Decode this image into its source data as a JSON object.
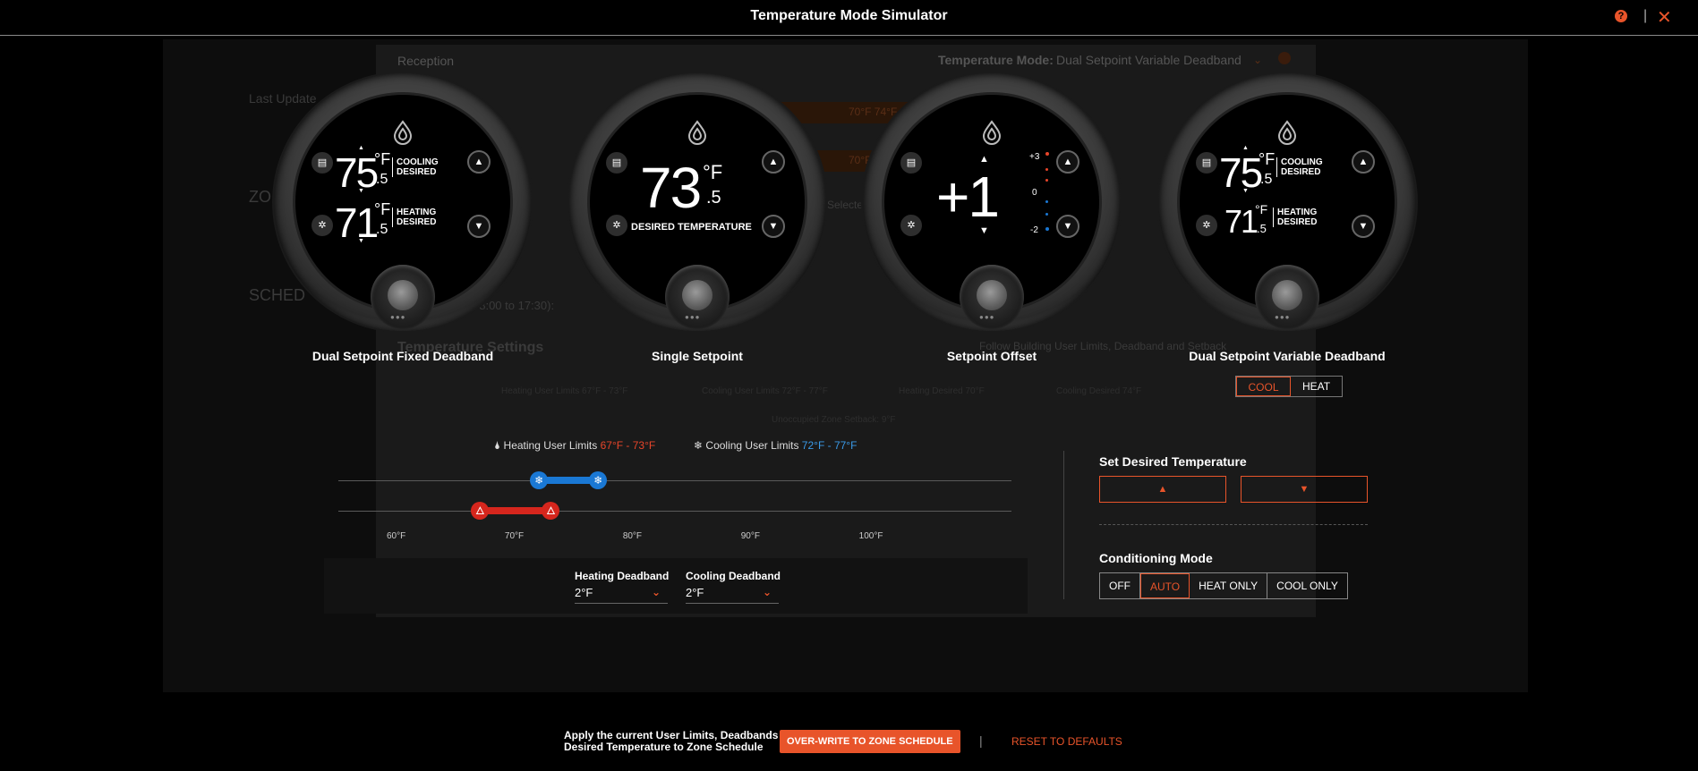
{
  "window": {
    "title": "Temperature Mode Simulator",
    "help_icon": "?",
    "separator": "|",
    "close_icon": "✕"
  },
  "background": {
    "zone": "Reception",
    "temperature_mode_label": "Temperature Mode:",
    "temperature_mode_value": "Dual Setpoint Variable Deadband",
    "temp_settings": "Temperature Settings",
    "follow_building": "Follow Building User Limits, Deadband and Setback",
    "range1": "70°F 74°F",
    "range2": "70°F",
    "selected": "Selected",
    "time": "08:00 to 17:30):",
    "last_updated": "Last Update",
    "zone_label": "ZO",
    "sched": "SCHED",
    "heating_limits_ghost": "Heating User Limits 67°F - 73°F",
    "cooling_limits_ghost": "Cooling User Limits 72°F - 77°F",
    "heating_desired_ghost": "Heating Desired 70°F",
    "cooling_desired_ghost": "Cooling Desired 74°F",
    "unoccupied": "Unoccupied Zone Setback: 9°F"
  },
  "thermostats": [
    {
      "name": "Dual Setpoint Fixed Deadband",
      "cool_temp": "75",
      "cool_half": ".5",
      "cool_unit": "°F",
      "cool_label1": "COOLING",
      "cool_label2": "DESIRED",
      "heat_temp": "71",
      "heat_half": ".5",
      "heat_unit": "°F",
      "heat_label1": "HEATING",
      "heat_label2": "DESIRED"
    },
    {
      "name": "Single Setpoint",
      "temp": "73",
      "half": ".5",
      "unit": "°F",
      "label": "DESIRED TEMPERATURE"
    },
    {
      "name": "Setpoint Offset",
      "offset": "+1",
      "scale_top": "+3",
      "scale_mid": "0",
      "scale_bot": "-2"
    },
    {
      "name": "Dual Setpoint Variable Deadband",
      "cool_temp": "75",
      "cool_half": ".5",
      "cool_unit": "°F",
      "cool_label1": "COOLING",
      "cool_label2": "DESIRED",
      "heat_temp": "71",
      "heat_half": ".5",
      "heat_unit": "°F",
      "heat_label1": "HEATING",
      "heat_label2": "DESIRED"
    }
  ],
  "cool_heat_toggle": {
    "cool": "COOL",
    "heat": "HEAT",
    "active": "COOL"
  },
  "limits": {
    "heating_label": "Heating User Limits",
    "heating_value": "67°F - 73°F",
    "cooling_label": "Cooling User Limits",
    "cooling_value": "72°F - 77°F",
    "heating_range_f": [
      67,
      73
    ],
    "cooling_range_f": [
      72,
      77
    ],
    "scale_f": [
      55,
      112
    ],
    "ticks": [
      "60°F",
      "70°F",
      "80°F",
      "90°F",
      "100°F"
    ]
  },
  "deadband": {
    "heating_label": "Heating Deadband",
    "heating_value": "2°F",
    "cooling_label": "Cooling Deadband",
    "cooling_value": "2°F"
  },
  "set_desired": {
    "title": "Set Desired Temperature",
    "up": "▲",
    "down": "▼"
  },
  "conditioning": {
    "title": "Conditioning Mode",
    "modes": [
      "OFF",
      "AUTO",
      "HEAT ONLY",
      "COOL ONLY"
    ],
    "active": "AUTO"
  },
  "footer": {
    "apply_line1": "Apply the current User Limits, Deadbands &",
    "apply_line2": "Desired Temperature to Zone Schedule",
    "overwrite": "OVER-WRITE TO ZONE SCHEDULE",
    "sep": "|",
    "reset": "RESET TO DEFAULTS"
  },
  "colors": {
    "accent": "#e8542a",
    "cooling": "#1a78d4",
    "heating": "#d6261d"
  }
}
